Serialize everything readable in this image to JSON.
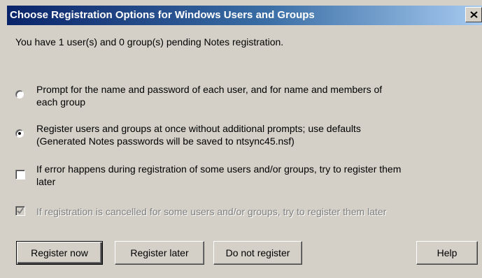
{
  "dialog": {
    "title": "Choose Registration Options for Windows Users and Groups",
    "message": "You have 1 user(s) and 0 group(s) pending Notes registration."
  },
  "options": {
    "radio_prompt": {
      "line1": "Prompt for the name and password of each user, and for name and members of",
      "line2": "each group",
      "selected": false
    },
    "radio_register_at_once": {
      "line1": "Register users and groups at once without additional prompts; use defaults",
      "line2": "(Generated Notes passwords will be saved to ntsync45.nsf)",
      "selected": true
    },
    "check_retry_on_error": {
      "line1": "If error happens during registration of some users and/or groups, try to register them",
      "line2": "later",
      "checked": false
    },
    "check_retry_on_cancel": {
      "label": "If registration is cancelled for some users and/or groups, try to register them later",
      "checked": true,
      "enabled": false
    }
  },
  "buttons": {
    "register_now": "Register now",
    "register_later": "Register later",
    "do_not_register": "Do not register",
    "help": "Help"
  }
}
